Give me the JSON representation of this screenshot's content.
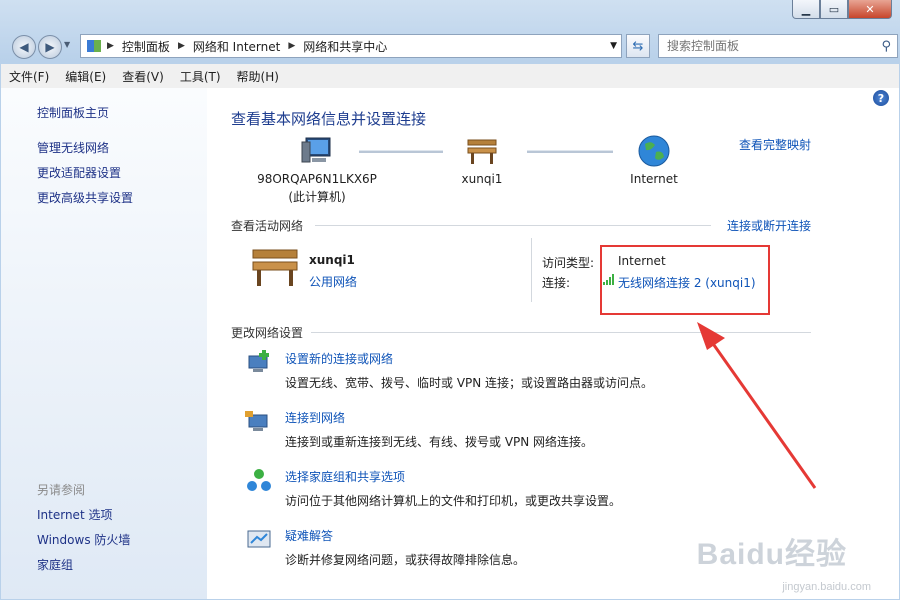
{
  "window": {
    "caption_buttons": [
      "minimize",
      "maximize",
      "close"
    ]
  },
  "address": {
    "breadcrumbs": [
      "控制面板",
      "网络和 Internet",
      "网络和共享中心"
    ],
    "search_placeholder": "搜索控制面板"
  },
  "menu": [
    "文件(F)",
    "编辑(E)",
    "查看(V)",
    "工具(T)",
    "帮助(H)"
  ],
  "sidebar": {
    "home": "控制面板主页",
    "items": [
      "管理无线网络",
      "更改适配器设置",
      "更改高级共享设置"
    ],
    "see_also_title": "另请参阅",
    "see_also": [
      "Internet 选项",
      "Windows 防火墙",
      "家庭组"
    ]
  },
  "main": {
    "title": "查看基本网络信息并设置连接",
    "full_map_link": "查看完整映射",
    "map": {
      "computer_name": "98ORQAP6N1LKX6P",
      "computer_sub": "(此计算机)",
      "network_name": "xunqi1",
      "internet": "Internet"
    },
    "active_title": "查看活动网络",
    "connect_disconnect": "连接或断开连接",
    "active": {
      "name": "xunqi1",
      "type": "公用网络",
      "access_type_label": "访问类型:",
      "access_type_value": "Internet",
      "connection_label": "连接:",
      "connection_value": "无线网络连接 2 (xunqi1)"
    },
    "change_title": "更改网络设置",
    "tasks": [
      {
        "title": "设置新的连接或网络",
        "desc": "设置无线、宽带、拨号、临时或 VPN 连接；或设置路由器或访问点。"
      },
      {
        "title": "连接到网络",
        "desc": "连接到或重新连接到无线、有线、拨号或 VPN 网络连接。"
      },
      {
        "title": "选择家庭组和共享选项",
        "desc": "访问位于其他网络计算机上的文件和打印机，或更改共享设置。"
      },
      {
        "title": "疑难解答",
        "desc": "诊断并修复网络问题，或获得故障排除信息。"
      }
    ]
  },
  "watermark": {
    "logo": "Baidu经验",
    "url": "jingyan.baidu.com"
  },
  "colors": {
    "link": "#0f54b8",
    "highlight_box": "#e53935",
    "arrow": "#e53935"
  }
}
